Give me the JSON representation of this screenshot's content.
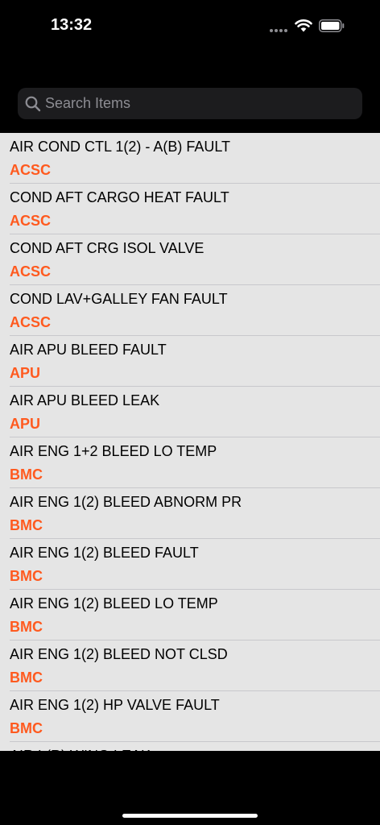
{
  "status_bar": {
    "time": "13:32"
  },
  "search": {
    "placeholder": "Search Items",
    "value": ""
  },
  "colors": {
    "accent": "#ff5a1f",
    "list_background": "#e5e5e5"
  },
  "items": [
    {
      "title": "AIR COND CTL 1(2) - A(B) FAULT",
      "system": "ACSC"
    },
    {
      "title": "COND AFT CARGO HEAT FAULT",
      "system": "ACSC"
    },
    {
      "title": "COND AFT CRG ISOL VALVE",
      "system": "ACSC"
    },
    {
      "title": "COND LAV+GALLEY FAN FAULT",
      "system": "ACSC"
    },
    {
      "title": "AIR APU BLEED FAULT",
      "system": "APU"
    },
    {
      "title": "AIR APU BLEED LEAK",
      "system": "APU"
    },
    {
      "title": "AIR ENG 1+2 BLEED LO TEMP",
      "system": "BMC"
    },
    {
      "title": "AIR ENG 1(2) BLEED ABNORM PR",
      "system": "BMC"
    },
    {
      "title": "AIR ENG 1(2) BLEED FAULT",
      "system": "BMC"
    },
    {
      "title": "AIR ENG 1(2) BLEED LO TEMP",
      "system": "BMC"
    },
    {
      "title": "AIR ENG 1(2) BLEED NOT CLSD",
      "system": "BMC"
    },
    {
      "title": "AIR ENG 1(2) HP VALVE FAULT",
      "system": "BMC"
    },
    {
      "title": "AIR L(R) WING LEAK",
      "system": ""
    }
  ]
}
